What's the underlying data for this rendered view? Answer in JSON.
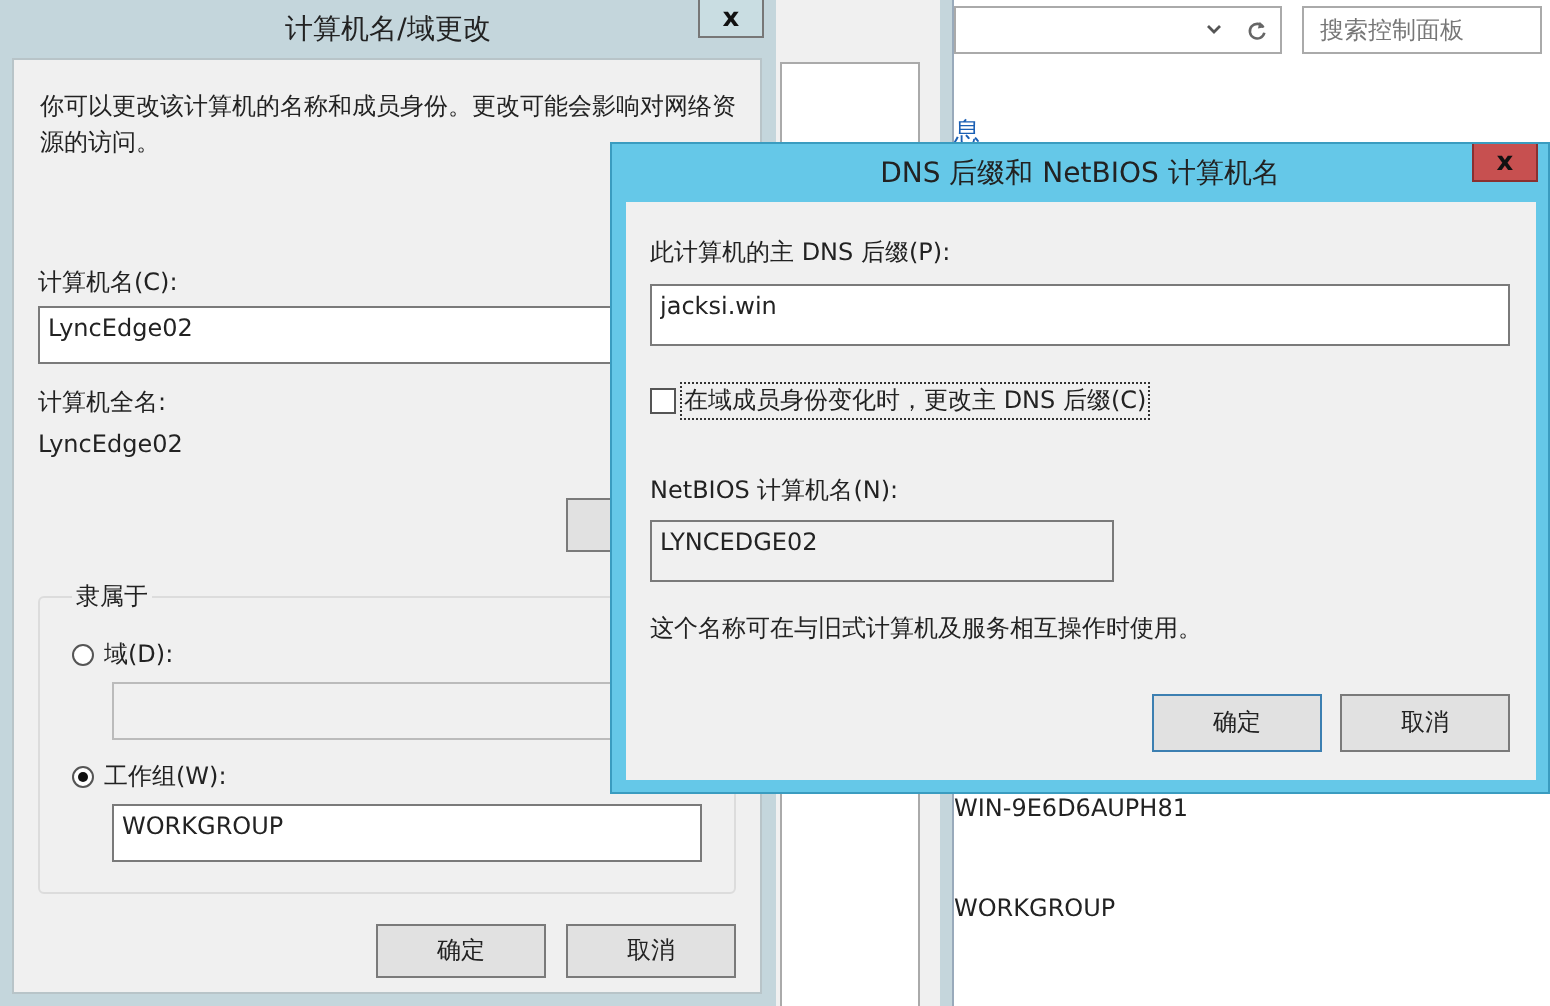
{
  "control_panel": {
    "search": {
      "placeholder": "搜索控制面板"
    },
    "section_link": "息",
    "computer_name": "WIN-9E6D6AUPH81",
    "workgroup": "WORKGROUP"
  },
  "computer_name_dialog": {
    "title": "计算机名/域更改",
    "close": "x",
    "description": "你可以更改该计算机的名称和成员身份。更改可能会影响对网络资源的访问。",
    "computer_name_label": "计算机名(C):",
    "computer_name_value": "LyncEdge02",
    "full_name_label": "计算机全名:",
    "full_name_value": "LyncEdge02",
    "member_of": {
      "label": "隶属于",
      "options": [
        {
          "label": "域(D):",
          "selected": false
        },
        {
          "label": "工作组(W):",
          "selected": true,
          "value": "WORKGROUP"
        }
      ]
    },
    "buttons": [
      {
        "label": "确定",
        "default": false
      },
      {
        "label": "取消",
        "default": false
      }
    ]
  },
  "dns_dialog": {
    "title": "DNS 后缀和 NetBIOS 计算机名",
    "close": "x",
    "primary_dns_label": "此计算机的主 DNS 后缀(P):",
    "primary_dns_value": "jacksi.win",
    "change_on_membership": {
      "label": "在域成员身份变化时，更改主 DNS 后缀(C)",
      "checked": false
    },
    "netbios_label": "NetBIOS 计算机名(N):",
    "netbios_value": "LYNCEDGE02",
    "note": "这个名称可在与旧式计算机及服务相互操作时使用。",
    "buttons": [
      {
        "label": "确定",
        "default": true
      },
      {
        "label": "取消",
        "default": false
      }
    ]
  }
}
